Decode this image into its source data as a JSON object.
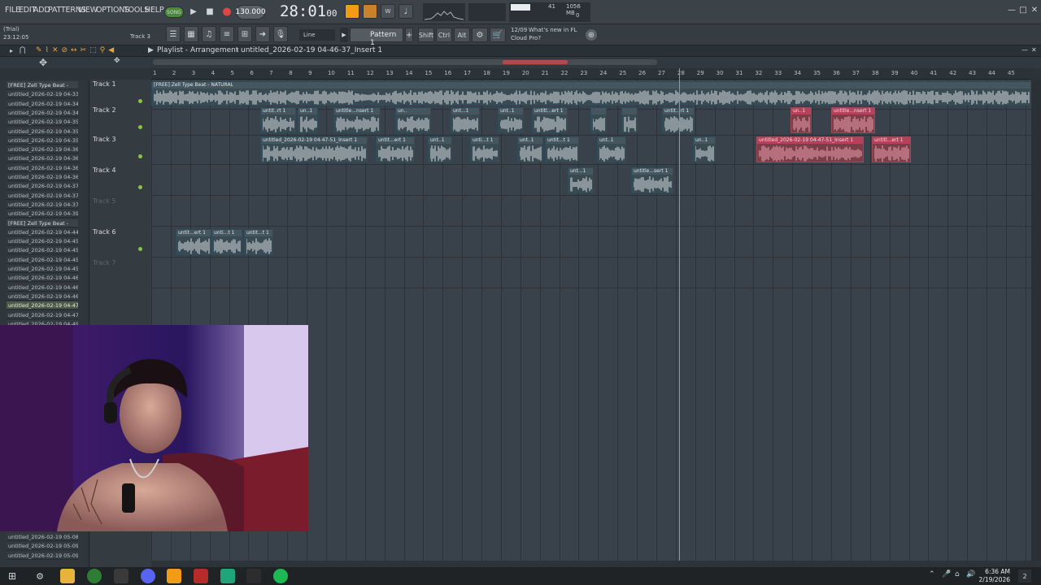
{
  "app": {
    "menu": [
      "FILE",
      "EDIT",
      "ADD",
      "PATTERNS",
      "VIEW",
      "OPTIONS",
      "TOOLS",
      "HELP"
    ],
    "song_mode": "SONG",
    "tempo": "130.000",
    "time": "28:01",
    "time_sub": "00",
    "cpu_value": "41",
    "mem_value": "1056 MB",
    "mem_sub": "0",
    "trial": "(Trial)",
    "clock_small": "23:12:05",
    "hint_track": "Track 3",
    "snap": "Line",
    "pattern": "Pattern 1",
    "modifiers": [
      "Shift",
      "Ctrl",
      "Alt"
    ],
    "news_date": "12/09",
    "news_text": "What's new in FL",
    "news_sub": "Cloud Pro?"
  },
  "playlist": {
    "title": "Playlist - Arrangement",
    "project": "untitled_2026-02-19 04-46-37_Insert 1",
    "ruler": [
      "1",
      "2",
      "3",
      "4",
      "5",
      "6",
      "7",
      "8",
      "9",
      "10",
      "11",
      "12",
      "13",
      "14",
      "15",
      "16",
      "17",
      "18",
      "19",
      "20",
      "21",
      "22",
      "23",
      "24",
      "25",
      "26",
      "27",
      "28",
      "29",
      "30",
      "31",
      "32",
      "33",
      "34",
      "35",
      "36",
      "37",
      "38",
      "39",
      "40",
      "41",
      "42",
      "43",
      "44",
      "45"
    ],
    "tracks": [
      {
        "name": "Track 1",
        "dim": false
      },
      {
        "name": "Track 2",
        "dim": false
      },
      {
        "name": "Track 3",
        "dim": false
      },
      {
        "name": "Track 4",
        "dim": false
      },
      {
        "name": "Track 5",
        "dim": true
      },
      {
        "name": "Track 6",
        "dim": false
      },
      {
        "name": "Track 7",
        "dim": true
      }
    ],
    "clips": [
      {
        "track": 0,
        "label": "[FREE] Zell Type Beat - NATURAL",
        "red": false,
        "start": 0,
        "end": 1082
      },
      {
        "track": 1,
        "label": "untit..rt 1",
        "red": false,
        "start": 134,
        "end": 178
      },
      {
        "track": 1,
        "label": "un..1",
        "red": false,
        "start": 180,
        "end": 205
      },
      {
        "track": 1,
        "label": "untitle...nsert 1",
        "red": false,
        "start": 224,
        "end": 282
      },
      {
        "track": 1,
        "label": "un..",
        "red": false,
        "start": 300,
        "end": 344
      },
      {
        "track": 1,
        "label": "unt...1",
        "red": false,
        "start": 368,
        "end": 404
      },
      {
        "track": 1,
        "label": "unt..1",
        "red": false,
        "start": 426,
        "end": 458
      },
      {
        "track": 1,
        "label": "untitl...ert 1",
        "red": false,
        "start": 468,
        "end": 512
      },
      {
        "track": 1,
        "label": "",
        "red": false,
        "start": 540,
        "end": 560
      },
      {
        "track": 1,
        "label": "",
        "red": false,
        "start": 578,
        "end": 598
      },
      {
        "track": 1,
        "label": "untit...rt 1",
        "red": false,
        "start": 628,
        "end": 668
      },
      {
        "track": 1,
        "label": "un..1",
        "red": true,
        "start": 786,
        "end": 812
      },
      {
        "track": 1,
        "label": "untitle...nsert 1",
        "red": true,
        "start": 836,
        "end": 890
      },
      {
        "track": 2,
        "label": "untitled_2026-02-19 04-47-51_Insert 1",
        "red": false,
        "start": 134,
        "end": 266
      },
      {
        "track": 2,
        "label": "untit...ert 1",
        "red": false,
        "start": 276,
        "end": 324
      },
      {
        "track": 2,
        "label": "unt..1",
        "red": false,
        "start": 340,
        "end": 370
      },
      {
        "track": 2,
        "label": "unti...t 1",
        "red": false,
        "start": 392,
        "end": 428
      },
      {
        "track": 2,
        "label": "unt..1",
        "red": false,
        "start": 450,
        "end": 482
      },
      {
        "track": 2,
        "label": "untit...t 1",
        "red": false,
        "start": 484,
        "end": 526
      },
      {
        "track": 2,
        "label": "unt..1",
        "red": false,
        "start": 548,
        "end": 584
      },
      {
        "track": 2,
        "label": "un..1",
        "red": false,
        "start": 666,
        "end": 694
      },
      {
        "track": 2,
        "label": "untitled_2026-02-19 04-47-51_Insert 1",
        "red": true,
        "start": 744,
        "end": 876
      },
      {
        "track": 2,
        "label": "untitl...ert 1",
        "red": true,
        "start": 886,
        "end": 934
      },
      {
        "track": 3,
        "label": "unt...1",
        "red": false,
        "start": 512,
        "end": 544
      },
      {
        "track": 3,
        "label": "untitle...sert 1",
        "red": false,
        "start": 590,
        "end": 642
      },
      {
        "track": 5,
        "label": "untit...ert 1",
        "red": false,
        "start": 30,
        "end": 74
      },
      {
        "track": 5,
        "label": "unti...t 1",
        "red": false,
        "start": 74,
        "end": 112
      },
      {
        "track": 5,
        "label": "untit...t 1",
        "red": false,
        "start": 114,
        "end": 150
      }
    ]
  },
  "browser": {
    "items": [
      {
        "label": "[FREE] Zell Type Beat -",
        "pat": true,
        "sel": false
      },
      {
        "label": "untitled_2026-02-19 04-33..",
        "pat": false,
        "sel": false
      },
      {
        "label": "untitled_2026-02-19 04-34..",
        "pat": false,
        "sel": false
      },
      {
        "label": "untitled_2026-02-19 04-34..",
        "pat": false,
        "sel": false
      },
      {
        "label": "untitled_2026-02-19 04-35..",
        "pat": false,
        "sel": false
      },
      {
        "label": "untitled_2026-02-19 04-35..",
        "pat": false,
        "sel": false
      },
      {
        "label": "untitled_2026-02-19 04-35..",
        "pat": false,
        "sel": false
      },
      {
        "label": "untitled_2026-02-19 04-36..",
        "pat": false,
        "sel": false
      },
      {
        "label": "untitled_2026-02-19 04-36..",
        "pat": false,
        "sel": false
      },
      {
        "label": "untitled_2026-02-19 04-36..",
        "pat": false,
        "sel": false
      },
      {
        "label": "untitled_2026-02-19 04-36..",
        "pat": false,
        "sel": false
      },
      {
        "label": "untitled_2026-02-19 04-37..",
        "pat": false,
        "sel": false
      },
      {
        "label": "untitled_2026-02-19 04-37..",
        "pat": false,
        "sel": false
      },
      {
        "label": "untitled_2026-02-19 04-37..",
        "pat": false,
        "sel": false
      },
      {
        "label": "untitled_2026-02-19 04-39..",
        "pat": false,
        "sel": false
      },
      {
        "label": "[FREE] Zell Type Beat -",
        "pat": true,
        "sel": false
      },
      {
        "label": "untitled_2026-02-19 04-44..",
        "pat": false,
        "sel": false
      },
      {
        "label": "untitled_2026-02-19 04-45..",
        "pat": false,
        "sel": false
      },
      {
        "label": "untitled_2026-02-19 04-45..",
        "pat": false,
        "sel": false
      },
      {
        "label": "untitled_2026-02-19 04-45..",
        "pat": false,
        "sel": false
      },
      {
        "label": "untitled_2026-02-19 04-45..",
        "pat": false,
        "sel": false
      },
      {
        "label": "untitled_2026-02-19 04-46..",
        "pat": false,
        "sel": false
      },
      {
        "label": "untitled_2026-02-19 04-46..",
        "pat": false,
        "sel": false
      },
      {
        "label": "untitled_2026-02-19 04-46..",
        "pat": false,
        "sel": false
      },
      {
        "label": "untitled_2026-02-19 04-47..",
        "pat": false,
        "sel": true
      },
      {
        "label": "untitled_2026-02-19 04-47..",
        "pat": false,
        "sel": false
      },
      {
        "label": "untitled_2026-02-19 04-49..",
        "pat": false,
        "sel": false
      }
    ],
    "bottom_items": [
      "untitled_2026-02-19 05-08..",
      "untitled_2026-02-19 05-09..",
      "untitled_2026-02-19 05-09.."
    ]
  },
  "taskbar": {
    "time": "6:36 AM",
    "date": "2/19/2026",
    "notif": "2"
  },
  "colors": {
    "accent": "#f29b16",
    "led": "#8ac24a",
    "clip_red": "#b3425a",
    "clip_blue": "#45565f"
  }
}
